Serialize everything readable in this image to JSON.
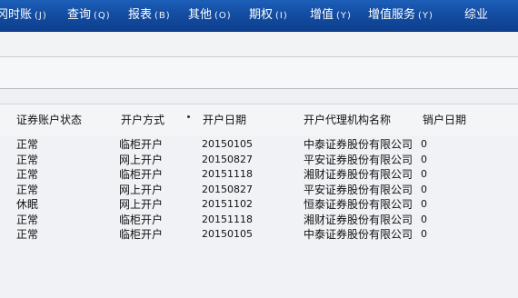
{
  "menu": [
    {
      "label": "冈时账",
      "key": "(J)"
    },
    {
      "label": "查询",
      "key": "(Q)"
    },
    {
      "label": "报表",
      "key": "(B)"
    },
    {
      "label": "其他",
      "key": "(O)"
    },
    {
      "label": "期权",
      "key": "(I)"
    },
    {
      "label": "增值",
      "key": "(Y)"
    },
    {
      "label": "增值服务",
      "key": "(Y)"
    },
    {
      "label": "综业",
      "key": ""
    }
  ],
  "table": {
    "headers": [
      "证券账户状态",
      "开户方式",
      "开户日期",
      "开户代理机构名称",
      "销户日期"
    ],
    "rows": [
      [
        "正常",
        "临柜开户",
        "20150105",
        "中泰证券股份有限公司",
        "0"
      ],
      [
        "正常",
        "网上开户",
        "20150827",
        "平安证券股份有限公司",
        "0"
      ],
      [
        "正常",
        "临柜开户",
        "20151118",
        "湘财证券股份有限公司",
        "0"
      ],
      [
        "正常",
        "网上开户",
        "20150827",
        "平安证券股份有限公司",
        "0"
      ],
      [
        "休眠",
        "网上开户",
        "20151102",
        "恒泰证券股份有限公司",
        "0"
      ],
      [
        "正常",
        "临柜开户",
        "20151118",
        "湘财证券股份有限公司",
        "0"
      ],
      [
        "正常",
        "临柜开户",
        "20150105",
        "中泰证券股份有限公司",
        "0"
      ]
    ]
  },
  "colors": {
    "menubar": "#134da2",
    "menu_text": "#ffffff",
    "grid_background": "#f1f2f5"
  }
}
